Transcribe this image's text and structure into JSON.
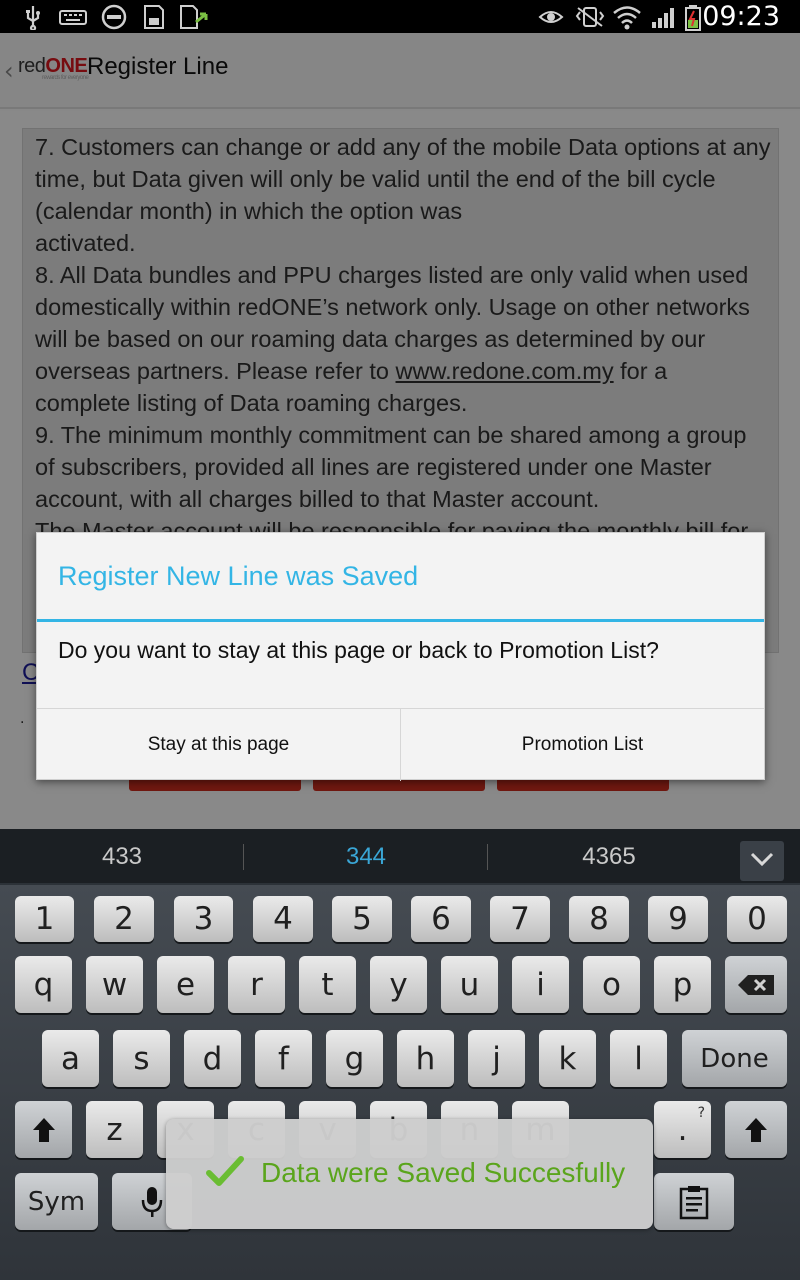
{
  "status_bar": {
    "time": "09:23",
    "icons": [
      "usb-icon",
      "keyboard-icon",
      "do-not-disturb-icon",
      "sd-card-icon",
      "file-transfer-icon",
      "eye-icon",
      "vibrate-icon",
      "wifi-icon",
      "signal-icon",
      "battery-charging-icon"
    ]
  },
  "action_bar": {
    "logo_red": "red",
    "logo_one": "ONE",
    "logo_tagline": "rewards for everyone",
    "title": "Register Line"
  },
  "terms": {
    "lines": [
      "7. Customers can change or add any of the mobile Data options at any",
      "time, but Data given will only be valid until the end of the bill cycle",
      "(calendar month) in which the option was",
      "activated.",
      "8. All Data bundles and PPU charges listed are only valid when used",
      "domestically within redONE’s network only. Usage on other networks",
      "will be based on our roaming data charges as determined by our",
      "overseas partners. Please refer to",
      "www.redone.com.my",
      "for a",
      "complete listing of Data roaming charges.",
      "9. The minimum monthly commitment can be shared among a group",
      "of subscribers, provided all lines are registered under one Master",
      "account, with all charges billed to that Master account.",
      "The Master account will be responsible for paying the monthly bill for"
    ],
    "partial_link_letter": "C",
    "dot": "."
  },
  "dialog": {
    "title": "Register New Line was Saved",
    "message": "Do you want to stay at this page or back to Promotion List?",
    "stay_label": "Stay at this page",
    "promo_label": "Promotion List"
  },
  "suggestions": [
    "433",
    "344",
    "4365"
  ],
  "keyboard": {
    "row1": [
      "1",
      "2",
      "3",
      "4",
      "5",
      "6",
      "7",
      "8",
      "9",
      "0"
    ],
    "row2": [
      "q",
      "w",
      "e",
      "r",
      "t",
      "y",
      "u",
      "i",
      "o",
      "p"
    ],
    "row3": [
      "a",
      "s",
      "d",
      "f",
      "g",
      "h",
      "j",
      "k",
      "l"
    ],
    "row4": [
      "z",
      "x",
      "c",
      "v",
      "b",
      "n",
      "m",
      "."
    ],
    "done_label": "Done",
    "sym_label": "Sym",
    "question_mark": "?"
  },
  "toast": {
    "text": "Data were Saved Succesfully"
  },
  "colors": {
    "accent_blue": "#33b5e5",
    "brand_red": "#c0141a",
    "toast_green": "#5aa51c"
  }
}
